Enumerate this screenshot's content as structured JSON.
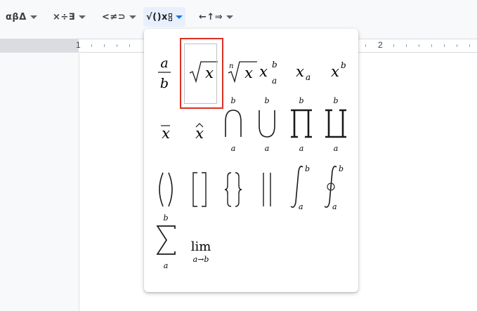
{
  "toolbar": {
    "groups": [
      {
        "label": "αβΔ",
        "active": false
      },
      {
        "label": "×÷∃",
        "active": false
      },
      {
        "label": "<≠⊃",
        "active": false
      },
      {
        "label": "√()x",
        "active": true
      },
      {
        "label": "←↑⇒",
        "active": false
      }
    ]
  },
  "ruler": {
    "left_number": "1",
    "right_number": "2"
  },
  "menu": {
    "items": [
      {
        "name": "fraction",
        "base": "a",
        "lower": "b"
      },
      {
        "name": "square-root",
        "base": "x"
      },
      {
        "name": "nth-root",
        "index": "n",
        "base": "x"
      },
      {
        "name": "sub-superscript",
        "base": "x",
        "sup": "b",
        "sub": "a"
      },
      {
        "name": "subscript",
        "base": "x",
        "sub": "a"
      },
      {
        "name": "superscript",
        "base": "x",
        "sup": "b"
      },
      {
        "name": "bar",
        "base": "x"
      },
      {
        "name": "hat",
        "base": "x"
      },
      {
        "name": "big-intersection",
        "sup": "b",
        "sub": "a"
      },
      {
        "name": "big-union",
        "sup": "b",
        "sub": "a"
      },
      {
        "name": "product",
        "sup": "b",
        "sub": "a"
      },
      {
        "name": "coproduct",
        "sup": "b",
        "sub": "a"
      },
      {
        "name": "parentheses"
      },
      {
        "name": "brackets"
      },
      {
        "name": "braces"
      },
      {
        "name": "absolute-value"
      },
      {
        "name": "integral",
        "sup": "b",
        "sub": "a"
      },
      {
        "name": "contour-integral",
        "sup": "b",
        "sub": "a"
      },
      {
        "name": "summation",
        "sup": "b",
        "sub": "a"
      },
      {
        "name": "limit",
        "op": "lim",
        "sub": "a→b"
      }
    ],
    "highlighted_item": "square-root"
  },
  "colors": {
    "highlight_border": "#d93025",
    "active_tab_bg": "#e8f0fe",
    "active_caret": "#1a73e8"
  }
}
